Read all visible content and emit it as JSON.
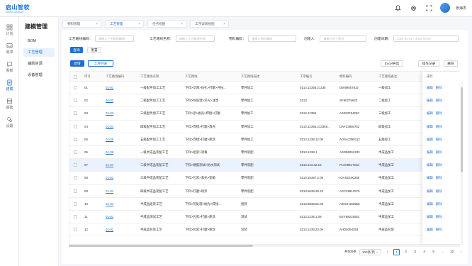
{
  "brand": {
    "name": "启山智软",
    "sub": "QISHAN ZHIRUAN"
  },
  "user": {
    "name": "张海杰"
  },
  "rail": [
    {
      "label": "计划",
      "icon": "grid-icon"
    },
    {
      "label": "需求",
      "icon": "inbox-icon"
    },
    {
      "label": "看板",
      "icon": "chat-icon"
    },
    {
      "label": "建模",
      "icon": "document-icon"
    },
    {
      "label": "基础",
      "icon": "database-icon"
    },
    {
      "label": "设置",
      "icon": "settings-icon"
    }
  ],
  "submenu": {
    "title": "建模管理",
    "items": [
      "BOM",
      "工艺管理",
      "辅助资源",
      "设备管理"
    ]
  },
  "tabs": [
    "物料管理",
    "工艺管理",
    "任务视图",
    "工序详情视图"
  ],
  "filters": {
    "f1": {
      "label": "工艺路线编码：",
      "placeholder": "请输入工艺路线编码"
    },
    "f2": {
      "label": "工艺路线名称：",
      "placeholder": "请输入工艺路线名称"
    },
    "f3": {
      "label": "物料编码：",
      "placeholder": "请输入物料编码"
    },
    "f4": {
      "label": "创建人：",
      "placeholder": "请输入员工姓名"
    },
    "f5": {
      "label": "创建日期：",
      "placeholder": "2022-03-01  ~  2022-03-30"
    }
  },
  "buttons": {
    "query": "查询",
    "reset": "重置",
    "add": "新增",
    "process_list": "工序列表",
    "excel": "Excel导出",
    "oplog": "操作记录",
    "delete": "删除"
  },
  "table": {
    "headers": [
      "序号",
      "工艺路线编码",
      "工艺路线名称",
      "工艺路线",
      "工艺路线描述",
      "工序编号",
      "物料编码",
      "工艺路线备注"
    ],
    "op_header": "操作",
    "op_edit": "编辑",
    "op_delete": "删除",
    "rows": [
      [
        "01",
        "01-01",
        "一级配件加工工艺",
        "下料>切割>钻孔>打磨>冲压...",
        "零件加工",
        "0213.12355.21335",
        "DW98657832",
        "一级加工"
      ],
      [
        "02",
        "01-02",
        "二级配件加工工艺",
        "下料>热处理>淬火>注塑",
        "零件加工",
        "0213.",
        "SF80275632",
        "二级加工"
      ],
      [
        "03",
        "01-03",
        "三级配件加工工艺",
        "下料>割>抛光>焊接>打磨",
        "零件加工",
        "0213.12355",
        "AS293754253",
        "三级加工"
      ],
      [
        "04",
        "01-04",
        "四级配件加工工艺",
        "下料>焊接>打磨>激光",
        "零件加工",
        "0213.12355.213355...",
        "DAF23856752",
        "四级加工"
      ],
      [
        "05",
        "01-05",
        "五级配件加工工艺",
        "下料>焊接>打磨>喷涂",
        "零件加工",
        "0213.1238.12.05",
        "ADSA2359112",
        "五级加工"
      ],
      [
        "06",
        "01-06",
        "一级半成品装配工艺",
        "下料>组装>消毒",
        "零件装配",
        "0213.1238.1",
        "ASD98261232",
        "半成品加工"
      ],
      [
        "07",
        "01-07",
        "二级半成品装配工艺",
        "下料>硬度测试>防水测试",
        "零件装配",
        "0213.123.a2.19",
        "PLK0981723d",
        "半成品加工"
      ],
      [
        "08",
        "01-01",
        "三级半成品装配工艺",
        "下料>包装>激光>装箱",
        "零件装配",
        "0213.15387.2.09",
        "IOASD190258",
        "半成品加工"
      ],
      [
        "09",
        "01-01",
        "四级半成品装配工艺",
        "下料>打磨>喷涂",
        "零件装配",
        "0213.5638.28.23",
        "ASC29812575",
        "半成品加工"
      ],
      [
        "10",
        "01-01",
        "半成品组装工艺",
        "下料>热处理>抛光>焊接...",
        "组装",
        "0213.8838.52.09",
        "AIDOH162555",
        "半成品加工"
      ],
      [
        "11",
        "01-01",
        "半成品测试工艺",
        "下料>包装>打磨>喷涂",
        "测试",
        "0213.1238.1.09",
        "BVY98215552",
        "半成品加工"
      ],
      [
        "12",
        "01-01",
        "半成品包装工艺",
        "下料>包装>打磨>喷涂",
        "包装",
        "0213.1238.23.09",
        "AHD9394253",
        "半成品包装"
      ]
    ]
  },
  "pager": {
    "total": "共500条",
    "size": "100条/页",
    "pages": [
      "1",
      "2",
      "3",
      "4",
      "5",
      "...",
      "10"
    ],
    "current": "1"
  }
}
